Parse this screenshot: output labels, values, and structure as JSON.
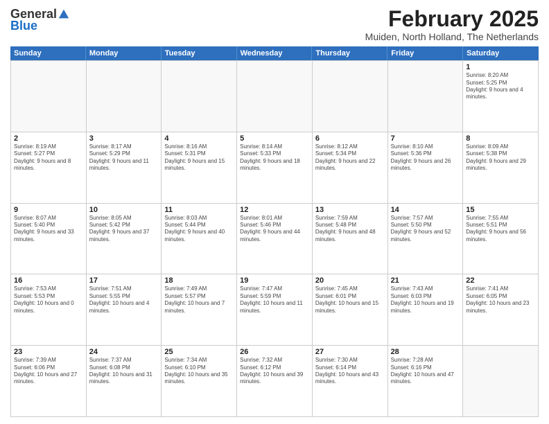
{
  "logo": {
    "general": "General",
    "blue": "Blue"
  },
  "title": "February 2025",
  "subtitle": "Muiden, North Holland, The Netherlands",
  "header_days": [
    "Sunday",
    "Monday",
    "Tuesday",
    "Wednesday",
    "Thursday",
    "Friday",
    "Saturday"
  ],
  "weeks": [
    [
      {
        "day": "",
        "info": ""
      },
      {
        "day": "",
        "info": ""
      },
      {
        "day": "",
        "info": ""
      },
      {
        "day": "",
        "info": ""
      },
      {
        "day": "",
        "info": ""
      },
      {
        "day": "",
        "info": ""
      },
      {
        "day": "1",
        "info": "Sunrise: 8:20 AM\nSunset: 5:25 PM\nDaylight: 9 hours and 4 minutes."
      }
    ],
    [
      {
        "day": "2",
        "info": "Sunrise: 8:19 AM\nSunset: 5:27 PM\nDaylight: 9 hours and 8 minutes."
      },
      {
        "day": "3",
        "info": "Sunrise: 8:17 AM\nSunset: 5:29 PM\nDaylight: 9 hours and 11 minutes."
      },
      {
        "day": "4",
        "info": "Sunrise: 8:16 AM\nSunset: 5:31 PM\nDaylight: 9 hours and 15 minutes."
      },
      {
        "day": "5",
        "info": "Sunrise: 8:14 AM\nSunset: 5:33 PM\nDaylight: 9 hours and 18 minutes."
      },
      {
        "day": "6",
        "info": "Sunrise: 8:12 AM\nSunset: 5:34 PM\nDaylight: 9 hours and 22 minutes."
      },
      {
        "day": "7",
        "info": "Sunrise: 8:10 AM\nSunset: 5:36 PM\nDaylight: 9 hours and 26 minutes."
      },
      {
        "day": "8",
        "info": "Sunrise: 8:09 AM\nSunset: 5:38 PM\nDaylight: 9 hours and 29 minutes."
      }
    ],
    [
      {
        "day": "9",
        "info": "Sunrise: 8:07 AM\nSunset: 5:40 PM\nDaylight: 9 hours and 33 minutes."
      },
      {
        "day": "10",
        "info": "Sunrise: 8:05 AM\nSunset: 5:42 PM\nDaylight: 9 hours and 37 minutes."
      },
      {
        "day": "11",
        "info": "Sunrise: 8:03 AM\nSunset: 5:44 PM\nDaylight: 9 hours and 40 minutes."
      },
      {
        "day": "12",
        "info": "Sunrise: 8:01 AM\nSunset: 5:46 PM\nDaylight: 9 hours and 44 minutes."
      },
      {
        "day": "13",
        "info": "Sunrise: 7:59 AM\nSunset: 5:48 PM\nDaylight: 9 hours and 48 minutes."
      },
      {
        "day": "14",
        "info": "Sunrise: 7:57 AM\nSunset: 5:50 PM\nDaylight: 9 hours and 52 minutes."
      },
      {
        "day": "15",
        "info": "Sunrise: 7:55 AM\nSunset: 5:51 PM\nDaylight: 9 hours and 56 minutes."
      }
    ],
    [
      {
        "day": "16",
        "info": "Sunrise: 7:53 AM\nSunset: 5:53 PM\nDaylight: 10 hours and 0 minutes."
      },
      {
        "day": "17",
        "info": "Sunrise: 7:51 AM\nSunset: 5:55 PM\nDaylight: 10 hours and 4 minutes."
      },
      {
        "day": "18",
        "info": "Sunrise: 7:49 AM\nSunset: 5:57 PM\nDaylight: 10 hours and 7 minutes."
      },
      {
        "day": "19",
        "info": "Sunrise: 7:47 AM\nSunset: 5:59 PM\nDaylight: 10 hours and 11 minutes."
      },
      {
        "day": "20",
        "info": "Sunrise: 7:45 AM\nSunset: 6:01 PM\nDaylight: 10 hours and 15 minutes."
      },
      {
        "day": "21",
        "info": "Sunrise: 7:43 AM\nSunset: 6:03 PM\nDaylight: 10 hours and 19 minutes."
      },
      {
        "day": "22",
        "info": "Sunrise: 7:41 AM\nSunset: 6:05 PM\nDaylight: 10 hours and 23 minutes."
      }
    ],
    [
      {
        "day": "23",
        "info": "Sunrise: 7:39 AM\nSunset: 6:06 PM\nDaylight: 10 hours and 27 minutes."
      },
      {
        "day": "24",
        "info": "Sunrise: 7:37 AM\nSunset: 6:08 PM\nDaylight: 10 hours and 31 minutes."
      },
      {
        "day": "25",
        "info": "Sunrise: 7:34 AM\nSunset: 6:10 PM\nDaylight: 10 hours and 35 minutes."
      },
      {
        "day": "26",
        "info": "Sunrise: 7:32 AM\nSunset: 6:12 PM\nDaylight: 10 hours and 39 minutes."
      },
      {
        "day": "27",
        "info": "Sunrise: 7:30 AM\nSunset: 6:14 PM\nDaylight: 10 hours and 43 minutes."
      },
      {
        "day": "28",
        "info": "Sunrise: 7:28 AM\nSunset: 6:16 PM\nDaylight: 10 hours and 47 minutes."
      },
      {
        "day": "",
        "info": ""
      }
    ]
  ]
}
